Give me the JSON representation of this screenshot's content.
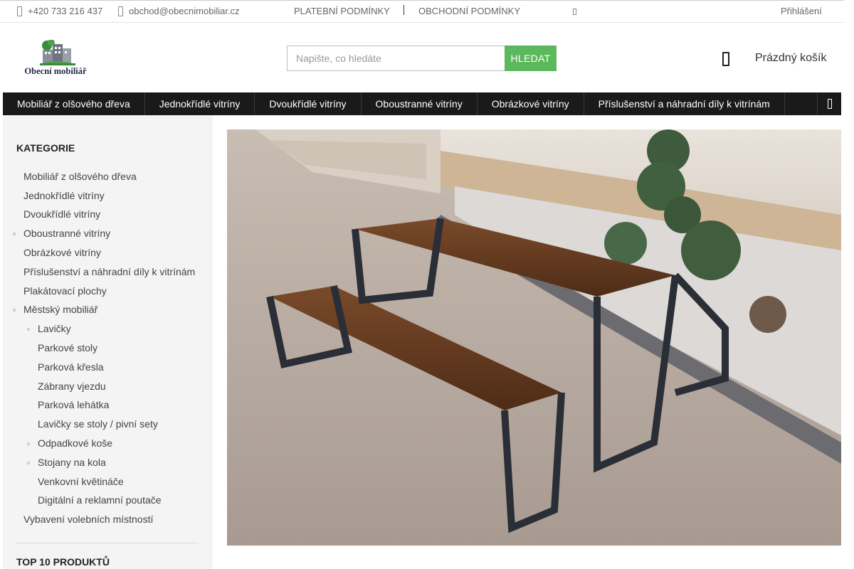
{
  "topbar": {
    "phone": "+420 733 216 437",
    "email": "obchod@obecnimobiliar.cz",
    "payment_terms": "PLATEBNÍ PODMÍNKY",
    "business_terms": "OBCHODNÍ PODMÍNKY",
    "login": "Přihlášení"
  },
  "header": {
    "logo_text": "Obecní mobiliář",
    "search_placeholder": "Napište, co hledáte",
    "search_button": "HLEDAT",
    "cart_label": "Prázdný košík"
  },
  "nav": {
    "items": [
      "Mobiliář z olšového dřeva",
      "Jednokřídlé vitríny",
      "Dvoukřídlé vitríny",
      "Oboustranné vitríny",
      "Obrázkové vitríny",
      "Příslušenství a náhradní díly k vitrínám"
    ]
  },
  "sidebar": {
    "categories_heading": "KATEGORIE",
    "top_heading": "TOP 10 PRODUKTŮ",
    "categories": [
      {
        "label": "Mobiliář z olšového dřeva",
        "level": 0,
        "has_children": false
      },
      {
        "label": "Jednokřídlé vitríny",
        "level": 0,
        "has_children": false
      },
      {
        "label": "Dvoukřídlé vitríny",
        "level": 0,
        "has_children": false
      },
      {
        "label": "Oboustranné vitríny",
        "level": 0,
        "has_children": true
      },
      {
        "label": "Obrázkové vitríny",
        "level": 0,
        "has_children": false
      },
      {
        "label": "Příslušenství a náhradní díly k vitrínám",
        "level": 0,
        "has_children": false
      },
      {
        "label": "Plakátovací plochy",
        "level": 0,
        "has_children": false
      },
      {
        "label": "Městský mobiliář",
        "level": 0,
        "has_children": true
      },
      {
        "label": "Lavičky",
        "level": 1,
        "has_children": true
      },
      {
        "label": "Parkové stoly",
        "level": 1,
        "has_children": false
      },
      {
        "label": "Parková křesla",
        "level": 1,
        "has_children": false
      },
      {
        "label": "Zábrany vjezdu",
        "level": 1,
        "has_children": false
      },
      {
        "label": "Parková lehátka",
        "level": 1,
        "has_children": false
      },
      {
        "label": "Lavičky se stoly / pivní sety",
        "level": 1,
        "has_children": false
      },
      {
        "label": "Odpadkové koše",
        "level": 1,
        "has_children": true
      },
      {
        "label": "Stojany na kola",
        "level": 1,
        "has_children": true
      },
      {
        "label": "Venkovní květináče",
        "level": 1,
        "has_children": false
      },
      {
        "label": "Digitální a reklamní poutače",
        "level": 1,
        "has_children": false
      },
      {
        "label": "Vybavení volebních místností",
        "level": 0,
        "has_children": false
      }
    ]
  },
  "colors": {
    "accent_green": "#5cb85c",
    "nav_background": "#1a1a1a",
    "sidebar_background": "#f4f4f4"
  },
  "icons": {
    "phone": "phone-icon",
    "email": "envelope-icon",
    "cart": "cart-icon",
    "nav_more": "chevron-right-icon"
  }
}
